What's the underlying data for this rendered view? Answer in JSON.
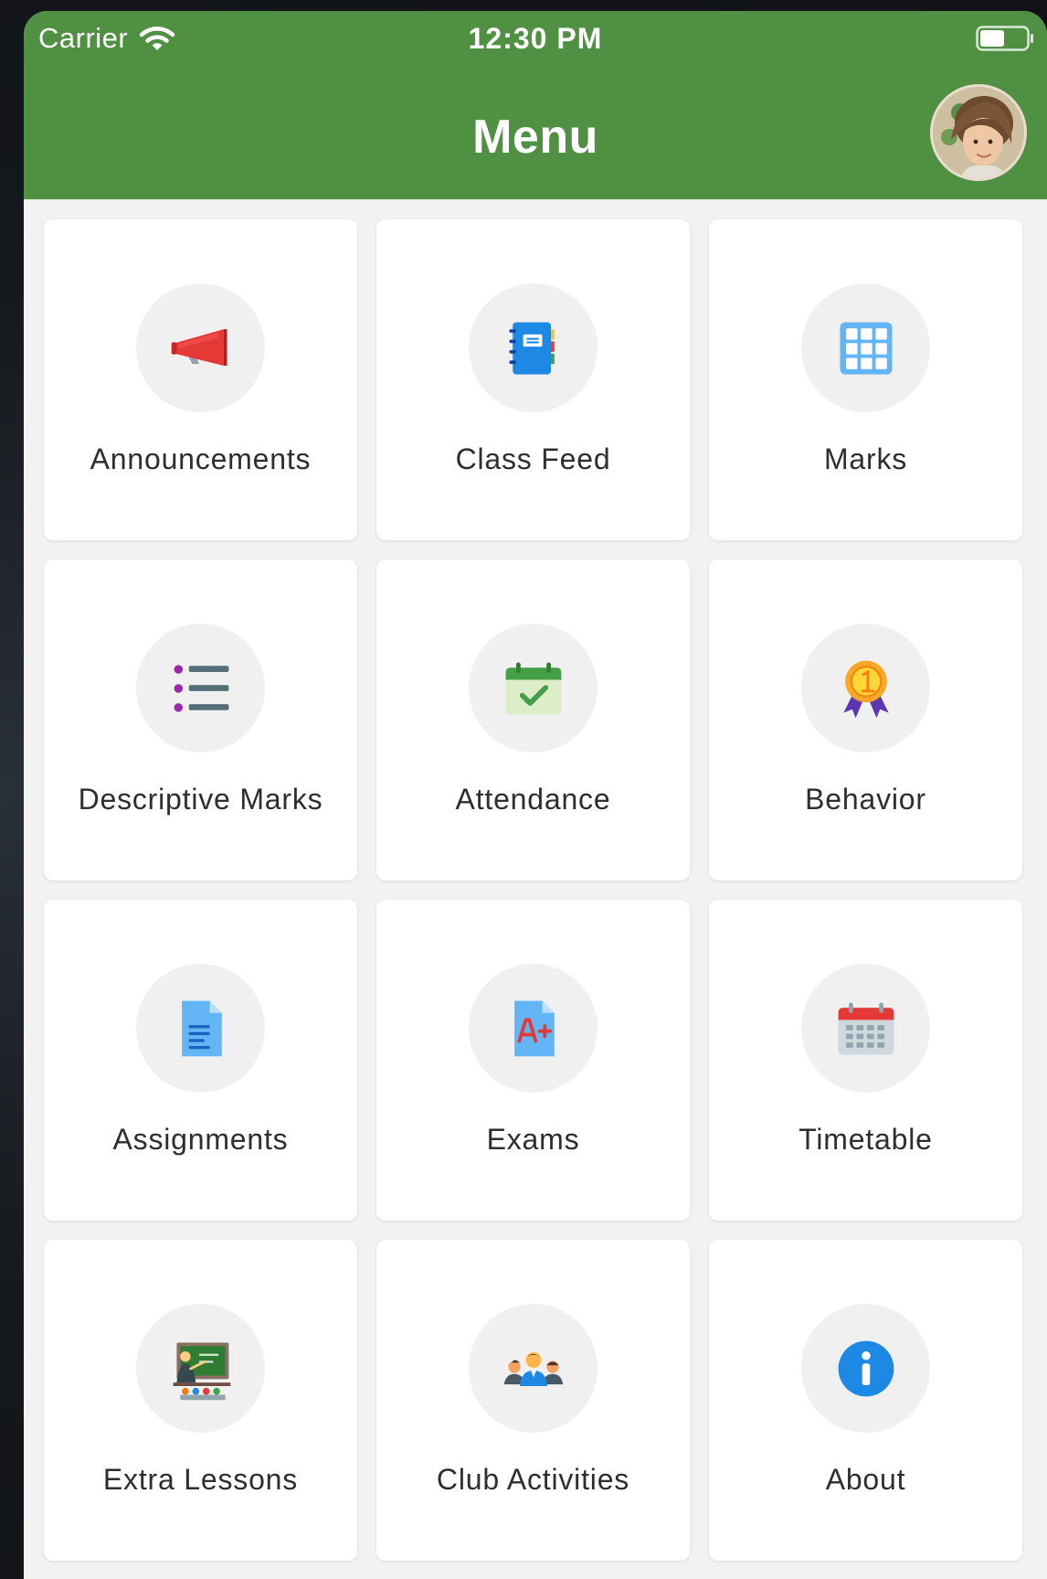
{
  "status_bar": {
    "carrier": "Carrier",
    "time": "12:30 PM"
  },
  "header": {
    "title": "Menu",
    "background_color": "#4f9043"
  },
  "menu": {
    "items": [
      {
        "label": "Announcements",
        "icon": "megaphone-icon"
      },
      {
        "label": "Class Feed",
        "icon": "notebook-icon"
      },
      {
        "label": "Marks",
        "icon": "grid-icon"
      },
      {
        "label": "Descriptive Marks",
        "icon": "list-icon"
      },
      {
        "label": "Attendance",
        "icon": "calendar-check-icon"
      },
      {
        "label": "Behavior",
        "icon": "medal-icon"
      },
      {
        "label": "Assignments",
        "icon": "document-icon"
      },
      {
        "label": "Exams",
        "icon": "grade-document-icon"
      },
      {
        "label": "Timetable",
        "icon": "calendar-icon"
      },
      {
        "label": "Extra Lessons",
        "icon": "teacher-board-icon"
      },
      {
        "label": "Club Activities",
        "icon": "group-icon"
      },
      {
        "label": "About",
        "icon": "info-icon"
      }
    ]
  }
}
